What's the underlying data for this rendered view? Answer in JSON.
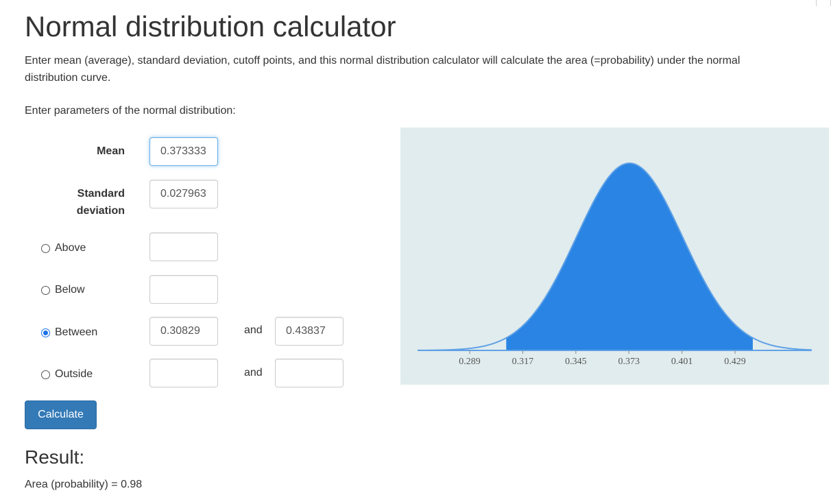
{
  "page": {
    "title": "Normal distribution calculator",
    "intro": "Enter mean (average), standard deviation, cutoff points, and this normal distribution calculator will calculate the area (=probability) under the normal distribution curve.",
    "params_label": "Enter parameters of the normal distribution:"
  },
  "form": {
    "mean_label": "Mean",
    "mean_value": "0.373333",
    "sd_label": "Standard deviation",
    "sd_value": "0.027963",
    "options": [
      {
        "label": "Above",
        "checked": false,
        "value1": "",
        "value2": null
      },
      {
        "label": "Below",
        "checked": false,
        "value1": "",
        "value2": null
      },
      {
        "label": "Between",
        "checked": true,
        "value1": "0.30829",
        "value2": "0.43837"
      },
      {
        "label": "Outside",
        "checked": false,
        "value1": "",
        "value2": ""
      }
    ],
    "and_label": "and",
    "calculate_label": "Calculate"
  },
  "result": {
    "heading": "Result:",
    "text": "Area (probability) = 0.98"
  },
  "colors": {
    "chart_background": "#e1ecee",
    "shaded_fill": "#2a84e3",
    "curve_line": "#5fa1e6",
    "button": "#337ab7"
  },
  "chart_data": {
    "type": "area",
    "distribution": "normal",
    "mean": 0.373333,
    "sd": 0.027963,
    "shaded_from": 0.30829,
    "shaded_to": 0.43837,
    "xlim": [
      0.2615,
      0.4695
    ],
    "tick_labels": [
      "0.289",
      "0.317",
      "0.345",
      "0.373",
      "0.401",
      "0.429"
    ],
    "tick_values": [
      0.289,
      0.317,
      0.345,
      0.373,
      0.401,
      0.429
    ],
    "grid": false,
    "title": "",
    "xlabel": "",
    "ylabel": ""
  }
}
